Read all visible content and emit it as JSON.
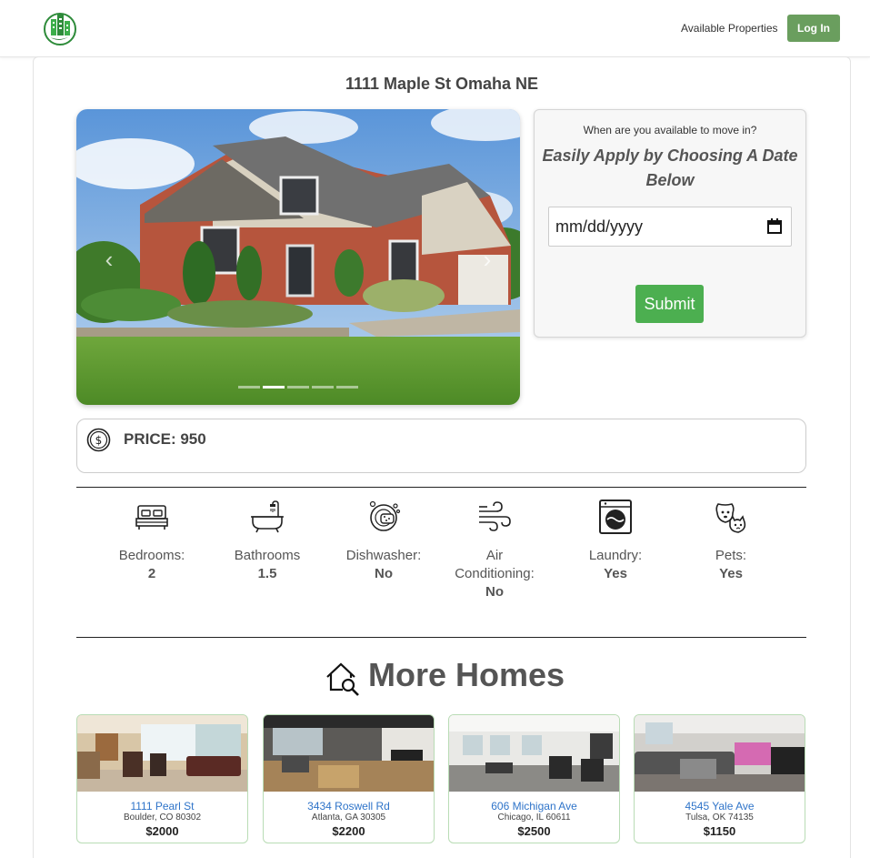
{
  "header": {
    "logo_icon": "city-buildings-leaf-logo",
    "nav_link": "Available Properties",
    "login_label": "Log In"
  },
  "property": {
    "address": "1111 Maple St Omaha NE",
    "carousel_slide_count": 5,
    "carousel_active_index": 1
  },
  "apply": {
    "question": "When are you available to move in?",
    "title": "Easily Apply by Choosing A Date Below",
    "date_placeholder": "mm/dd/yyyy",
    "submit_label": "Submit"
  },
  "price": {
    "label": "PRICE: 950",
    "icon": "dollar-coin-icon"
  },
  "amenities": [
    {
      "icon": "bed-icon",
      "label": "Bedrooms:",
      "value": "2"
    },
    {
      "icon": "bathtub-icon",
      "label": "Bathrooms",
      "value": "1.5"
    },
    {
      "icon": "dishwasher-icon",
      "label": "Dishwasher:",
      "value": "No"
    },
    {
      "icon": "wind-icon",
      "label": "Air Conditioning:",
      "value": "No"
    },
    {
      "icon": "washing-machine-icon",
      "label": "Laundry:",
      "value": "Yes"
    },
    {
      "icon": "pets-icon",
      "label": "Pets:",
      "value": "Yes"
    }
  ],
  "more_homes": {
    "title": "More Homes",
    "icon": "house-search-icon",
    "homes": [
      {
        "street": "1111 Pearl St",
        "city": "Boulder, CO 80302",
        "price": "$2000"
      },
      {
        "street": "3434 Roswell Rd",
        "city": "Atlanta, GA 30305",
        "price": "$2200"
      },
      {
        "street": "606 Michigan Ave",
        "city": "Chicago, IL 60611",
        "price": "$2500"
      },
      {
        "street": "4545 Yale Ave",
        "city": "Tulsa, OK 74135",
        "price": "$1150"
      }
    ]
  },
  "colors": {
    "brand_green": "#6a9e5e",
    "submit_green": "#4caf50",
    "link_blue": "#2f74c9",
    "card_border_green": "#b9dcb5"
  }
}
